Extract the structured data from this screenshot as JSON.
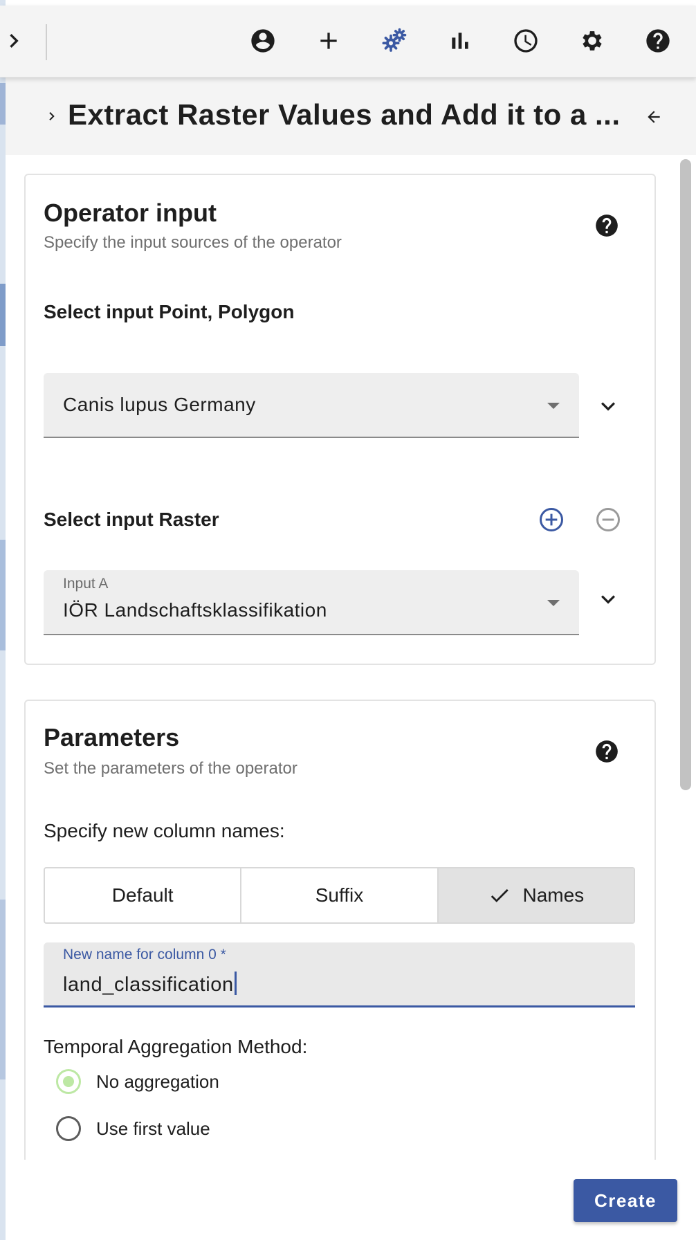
{
  "toolbar": {
    "icons": [
      "chevron-right-icon",
      "account-icon",
      "add-icon",
      "operators-icon",
      "bar-chart-icon",
      "clock-icon",
      "gear-icon",
      "help-icon"
    ],
    "active_icon": "operators-icon",
    "accent_color": "#3b59a3"
  },
  "header": {
    "title": "Extract Raster Values and Add it to a ..."
  },
  "operator_input": {
    "title": "Operator input",
    "subtitle": "Specify the input sources of the operator",
    "point_polygon": {
      "label": "Select input Point, Polygon",
      "value": "Canis lupus Germany"
    },
    "raster": {
      "label": "Select input Raster",
      "input_label": "Input A",
      "value": "IÖR Landschaftsklassifikation"
    }
  },
  "parameters": {
    "title": "Parameters",
    "subtitle": "Set the parameters of the operator",
    "column_names_label": "Specify new column names:",
    "toggle_options": [
      {
        "label": "Default",
        "selected": false
      },
      {
        "label": "Suffix",
        "selected": false
      },
      {
        "label": "Names",
        "selected": true
      }
    ],
    "column_field": {
      "label": "New name for column 0 *",
      "value": "land_classification"
    },
    "aggregation_label": "Temporal Aggregation Method:",
    "aggregation_options": [
      {
        "label": "No aggregation",
        "selected": true
      },
      {
        "label": "Use first value",
        "selected": false
      }
    ]
  },
  "actions": {
    "create_label": "Create"
  }
}
